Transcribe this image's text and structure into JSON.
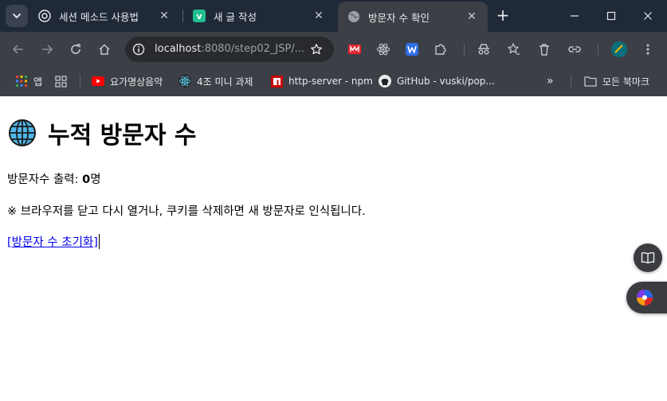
{
  "browser": {
    "tabs": [
      {
        "title": "세션 메소드 사용법",
        "active": false
      },
      {
        "title": "새 글 작성",
        "active": false
      },
      {
        "title": "방문자 수 확인",
        "active": true
      }
    ],
    "address": {
      "host": "localhost",
      "path": ":8080/step02_JSP/..."
    },
    "bookmarks": [
      {
        "label": "앱"
      },
      {
        "label": "요가명상음악"
      },
      {
        "label": "4조 미니 과제"
      },
      {
        "label": "http-server - npm"
      },
      {
        "label": "GitHub - vuski/pop..."
      },
      {
        "label": "모든 북마크"
      }
    ],
    "overflow_label": "»",
    "colors": {
      "frame": "#1f2937",
      "toolbar": "#3c3f45",
      "link": "#0000ee"
    }
  },
  "page": {
    "title": "누적 방문자 수",
    "counter_label": "방문자수 출력: ",
    "count": "0",
    "count_unit": "명",
    "notice": "※ 브라우저를 닫고 다시 열거나, 쿠키를 삭제하면 새 방문자로 인식됩니다.",
    "reset_link": "[방문자 수 초기화]"
  }
}
